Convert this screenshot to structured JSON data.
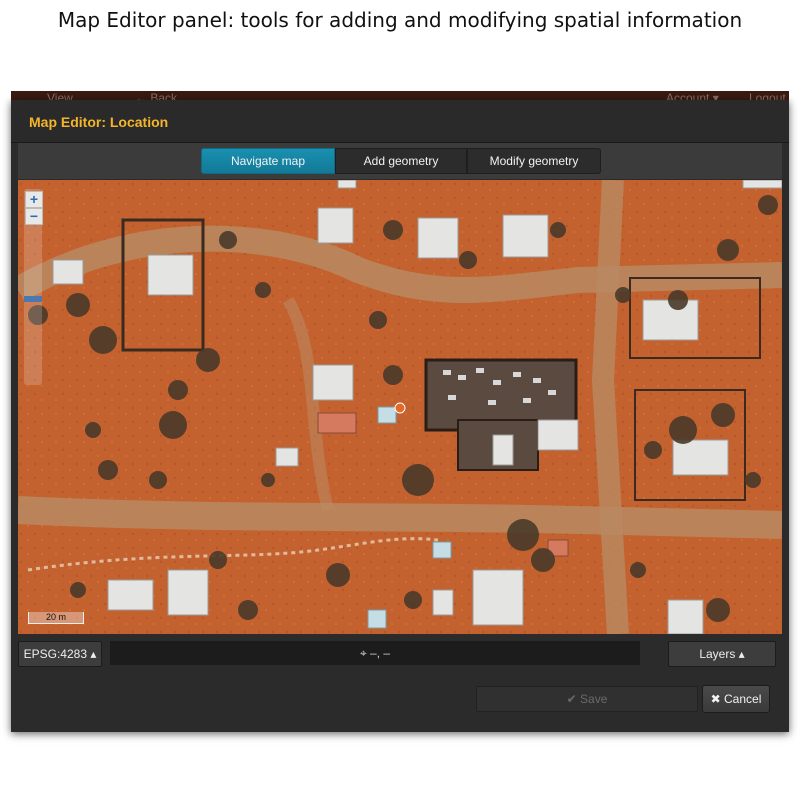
{
  "caption": "Map Editor panel: tools for adding and modifying spatial information",
  "background_app": {
    "view": "View",
    "back": "← Back",
    "account": "Account ▾",
    "logout": "Logout"
  },
  "dialog": {
    "title": "Map Editor: Location",
    "tabs": [
      {
        "label": "Navigate map",
        "active": true
      },
      {
        "label": "Add geometry",
        "active": false
      },
      {
        "label": "Modify geometry",
        "active": false
      }
    ]
  },
  "map": {
    "zoom_in": "+",
    "zoom_out": "−",
    "scale_label": "20 m",
    "zoom_level_fraction": 0.45
  },
  "bottombar": {
    "projection": "EPSG:4283 ▴",
    "coordinates": "⌖ –, –",
    "layers": "Layers ▴"
  },
  "footer": {
    "save": "✔ Save",
    "cancel": "✖ Cancel"
  },
  "colors": {
    "title_accent": "#f4b52a",
    "active_tab": "#1a8fb0",
    "location_marker": "#e06a2a"
  }
}
